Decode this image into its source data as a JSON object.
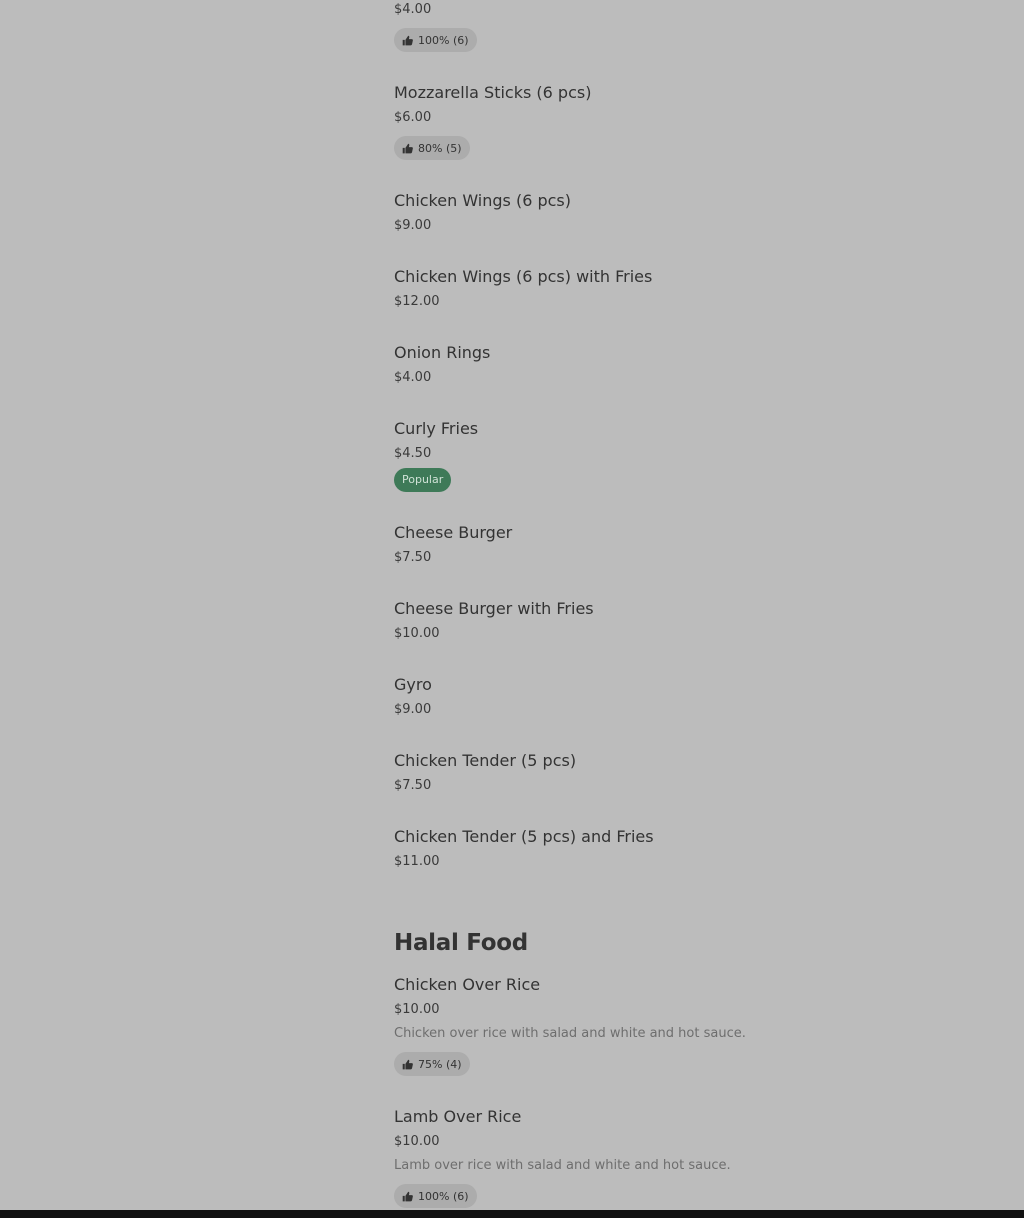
{
  "items": [
    {
      "price": "$4.00",
      "rating": "100% (6)"
    },
    {
      "name": "Mozzarella Sticks (6 pcs)",
      "price": "$6.00",
      "rating": "80% (5)"
    },
    {
      "name": "Chicken Wings (6 pcs)",
      "price": "$9.00"
    },
    {
      "name": "Chicken Wings (6 pcs) with Fries",
      "price": "$12.00"
    },
    {
      "name": "Onion Rings",
      "price": "$4.00"
    },
    {
      "name": "Curly Fries",
      "price": "$4.50",
      "badge": "Popular"
    },
    {
      "name": "Cheese Burger",
      "price": "$7.50"
    },
    {
      "name": "Cheese Burger with Fries",
      "price": "$10.00"
    },
    {
      "name": "Gyro",
      "price": "$9.00"
    },
    {
      "name": "Chicken Tender (5 pcs)",
      "price": "$7.50"
    },
    {
      "name": "Chicken Tender (5 pcs) and Fries",
      "price": "$11.00"
    }
  ],
  "halal_section": {
    "title": "Halal Food",
    "items": [
      {
        "name": "Chicken Over Rice",
        "price": "$10.00",
        "description": "Chicken over rice with salad and white and hot sauce.",
        "rating": "75% (4)"
      },
      {
        "name": "Lamb Over Rice",
        "price": "$10.00",
        "description": "Lamb over rice with salad and white and hot sauce.",
        "rating": "100% (6)"
      }
    ]
  },
  "colors": {
    "overlay_background": "#bcbcbc",
    "popular_badge": "#3e7a58",
    "rating_pill": "#acacac"
  },
  "icons": {
    "rating": "thumbs-up-icon"
  }
}
